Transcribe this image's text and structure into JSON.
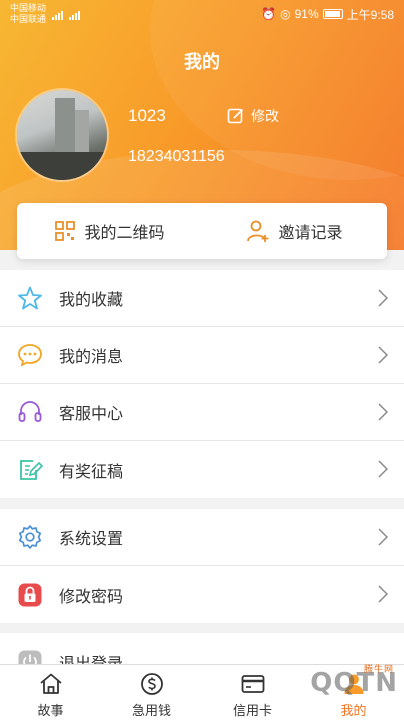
{
  "status": {
    "carrier1": "中国移动",
    "carrier2": "中国联通",
    "battery": "91%",
    "time": "上午9:58"
  },
  "header": {
    "title": "我的",
    "username": "1023",
    "edit_label": "修改",
    "phone": "18234031156"
  },
  "quick": {
    "qrcode_label": "我的二维码",
    "invite_label": "邀请记录"
  },
  "menu1": [
    {
      "label": "我的收藏",
      "icon": "star-icon"
    },
    {
      "label": "我的消息",
      "icon": "message-icon"
    },
    {
      "label": "客服中心",
      "icon": "headset-icon"
    },
    {
      "label": "有奖征稿",
      "icon": "edit-document-icon"
    }
  ],
  "menu2": [
    {
      "label": "系统设置",
      "icon": "gear-icon"
    },
    {
      "label": "修改密码",
      "icon": "lock-icon"
    }
  ],
  "menu3": [
    {
      "label": "退出登录",
      "icon": "power-icon"
    }
  ],
  "tabs": [
    {
      "label": "故事",
      "icon": "home-icon"
    },
    {
      "label": "急用钱",
      "icon": "piggy-bank-icon"
    },
    {
      "label": "信用卡",
      "icon": "credit-card-icon"
    },
    {
      "label": "我的",
      "icon": "user-icon"
    }
  ],
  "watermark": {
    "text": "QQTN",
    "sub": "腾牛网"
  },
  "colors": {
    "accent": "#f89b2a",
    "accent_dark": "#f47421",
    "star": "#4fb8e8",
    "message": "#f2a623",
    "headset": "#9b59d6",
    "editdoc": "#3cc2a6",
    "gear": "#4a90d9",
    "lock": "#e84b4b"
  }
}
